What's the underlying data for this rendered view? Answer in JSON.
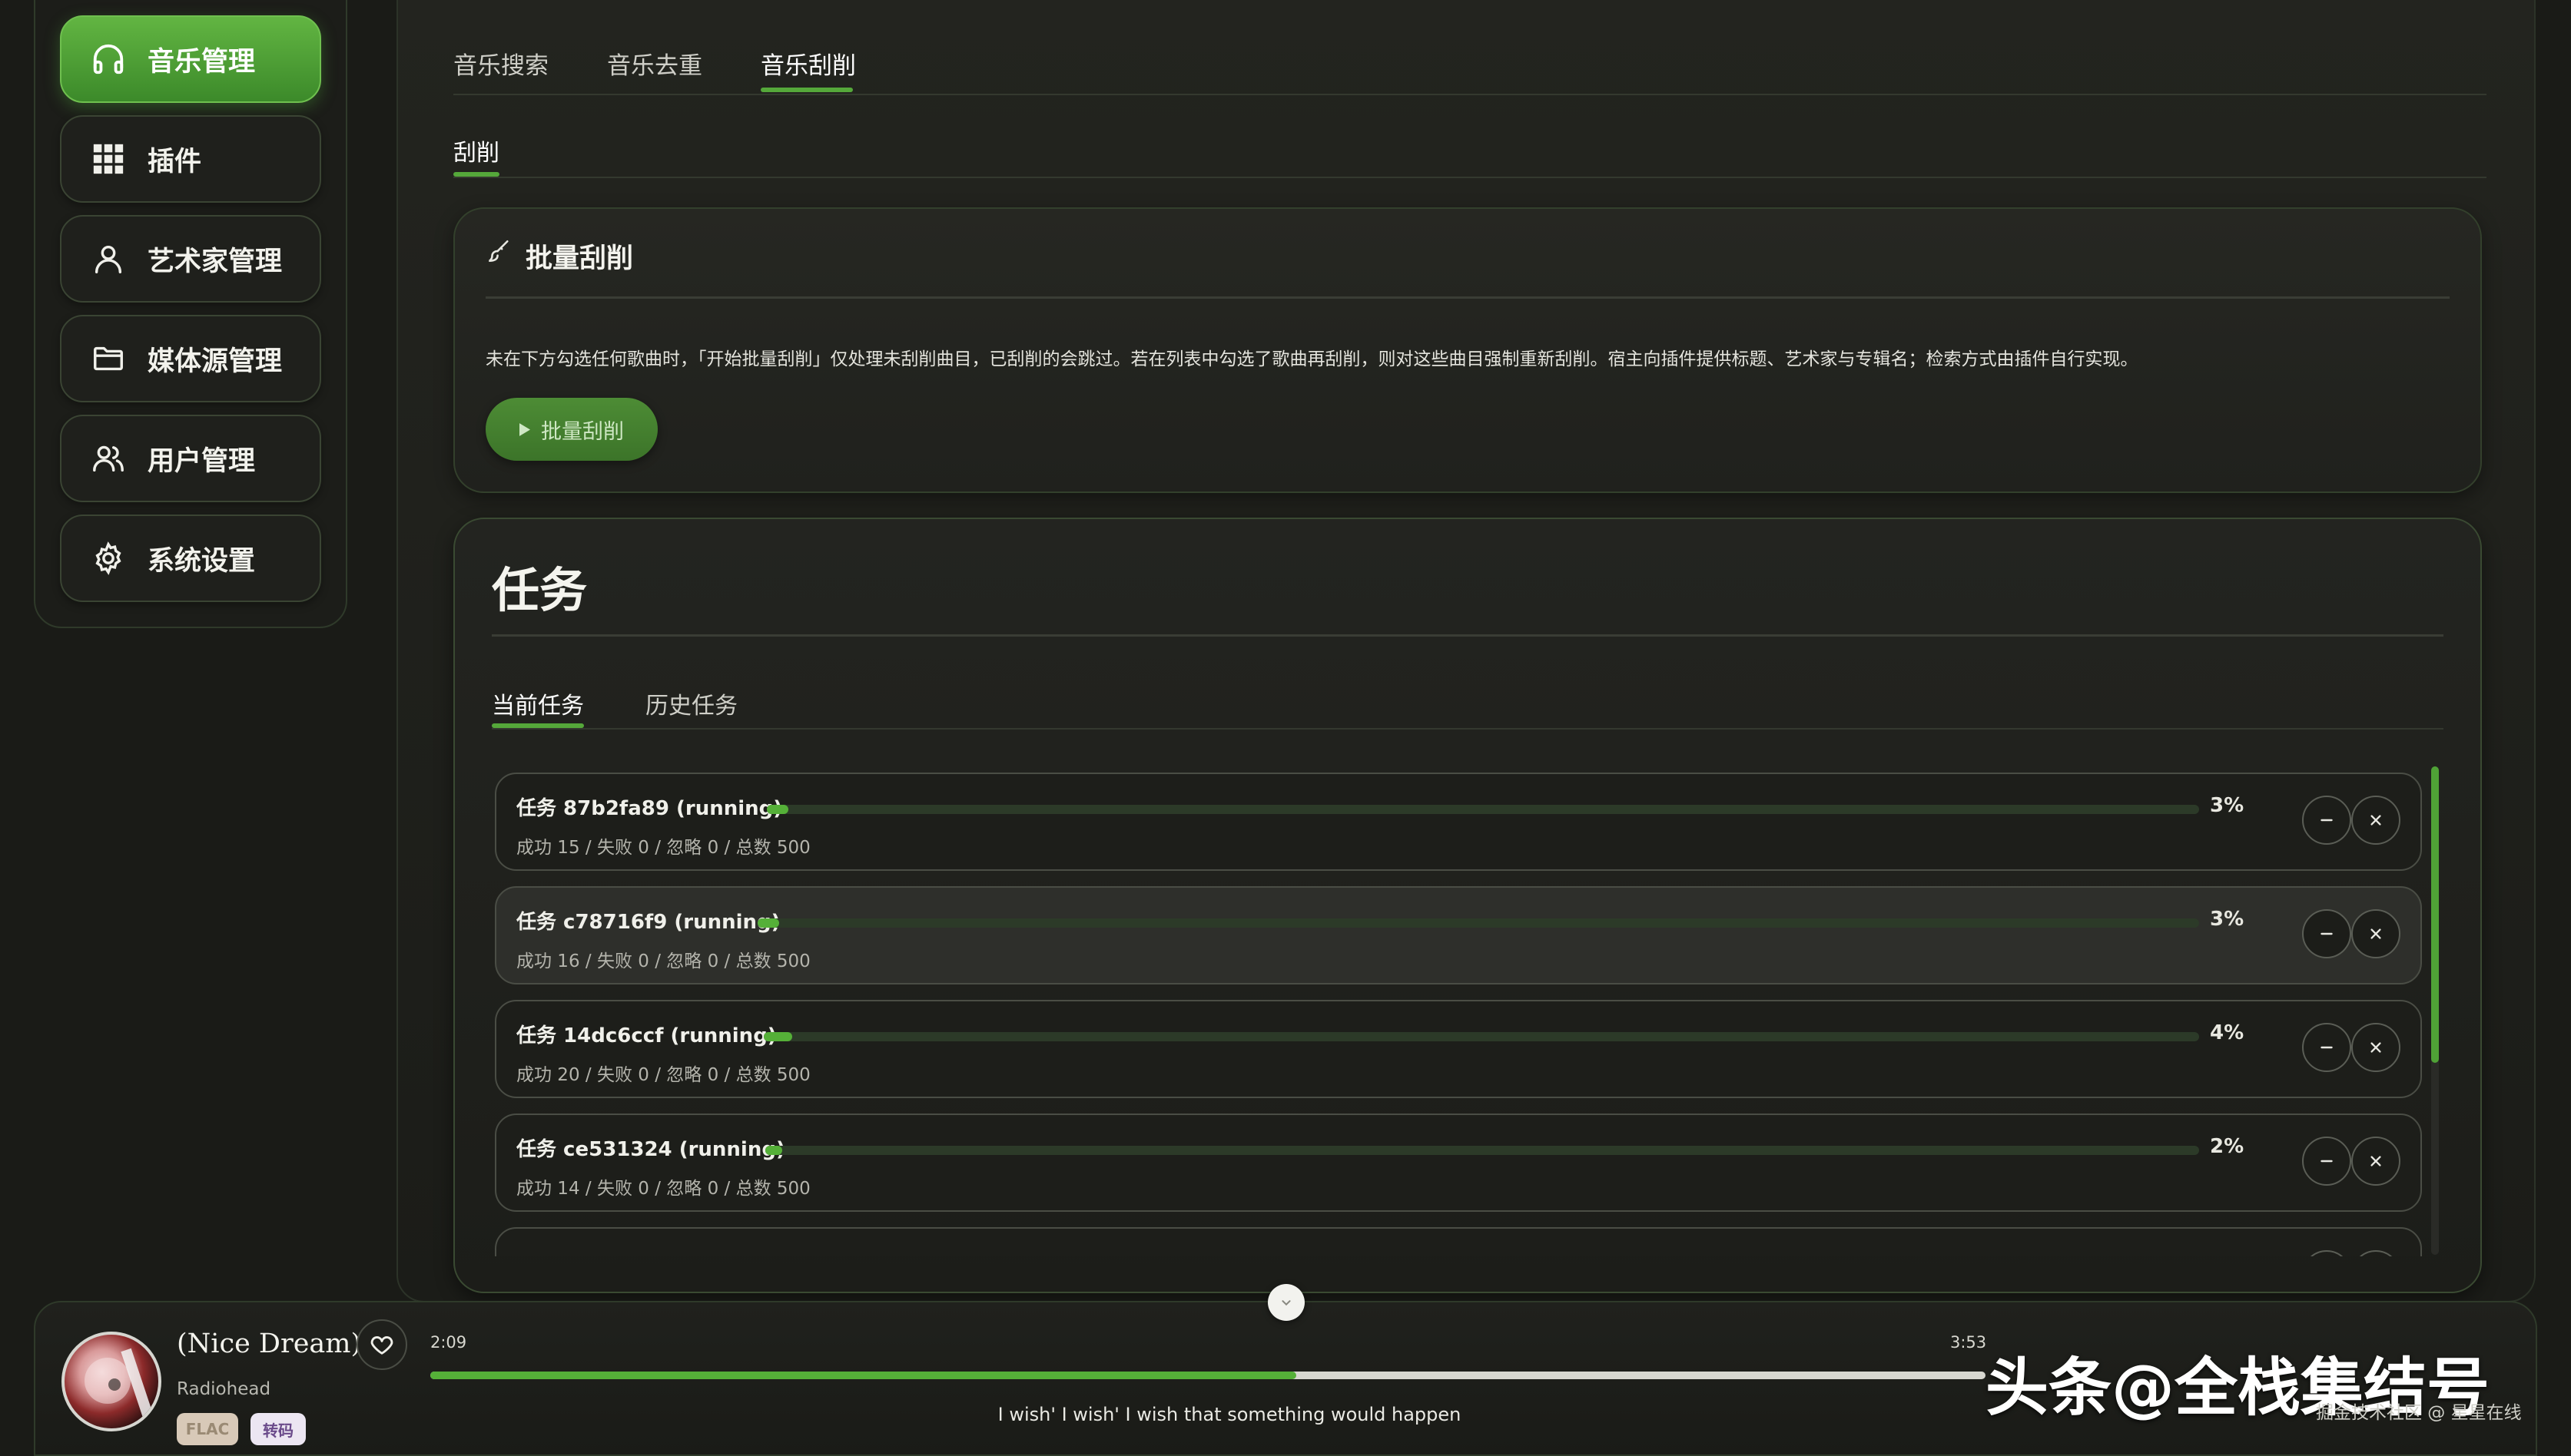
{
  "sidebar": {
    "items": [
      {
        "label": "音乐管理",
        "icon": "headphones-icon",
        "active": true
      },
      {
        "label": "插件",
        "icon": "grid-icon",
        "active": false
      },
      {
        "label": "艺术家管理",
        "icon": "user-icon",
        "active": false
      },
      {
        "label": "媒体源管理",
        "icon": "folder-icon",
        "active": false
      },
      {
        "label": "用户管理",
        "icon": "users-icon",
        "active": false
      },
      {
        "label": "系统设置",
        "icon": "gear-icon",
        "active": false
      }
    ]
  },
  "main": {
    "tabs": [
      "音乐搜索",
      "音乐去重",
      "音乐刮削"
    ],
    "active_tab": "音乐刮削",
    "subtab": "刮削"
  },
  "batch": {
    "title": "批量刮削",
    "description": "未在下方勾选任何歌曲时，「开始批量刮削」仅处理未刮削曲目，已刮削的会跳过。若在列表中勾选了歌曲再刮削，则对这些曲目强制重新刮削。宿主向插件提供标题、艺术家与专辑名；检索方式由插件自行实现。",
    "button_label": "批量刮削"
  },
  "tasks": {
    "title": "任务",
    "tabs": [
      "当前任务",
      "历史任务"
    ],
    "active_tab": "当前任务",
    "items": [
      {
        "title": "任务 87b2fa89 (running)",
        "summary": "成功 15 / 失败 0 / 忽略 0 / 总数 500",
        "percent": 3,
        "percent_label": "3%"
      },
      {
        "title": "任务 c78716f9 (running)",
        "summary": "成功 16 / 失败 0 / 忽略 0 / 总数 500",
        "percent": 3,
        "percent_label": "3%"
      },
      {
        "title": "任务 14dc6ccf (running)",
        "summary": "成功 20 / 失败 0 / 忽略 0 / 总数 500",
        "percent": 4,
        "percent_label": "4%"
      },
      {
        "title": "任务 ce531324 (running)",
        "summary": "成功 14 / 失败 0 / 忽略 0 / 总数 500",
        "percent": 2,
        "percent_label": "2%"
      }
    ]
  },
  "player": {
    "title": "(Nice Dream)",
    "artist": "Radiohead",
    "badges": [
      "FLAC",
      "转码"
    ],
    "current_time": "2:09",
    "total_time": "3:53",
    "progress": 0.557,
    "lyric": "I wish' I wish' I wish that something would happen"
  },
  "watermark": {
    "main": "头条@全栈集结号",
    "sub": "掘金技术社区 @ 星星在线"
  },
  "colors": {
    "accent": "#55b038",
    "background": "#1a1b17"
  }
}
